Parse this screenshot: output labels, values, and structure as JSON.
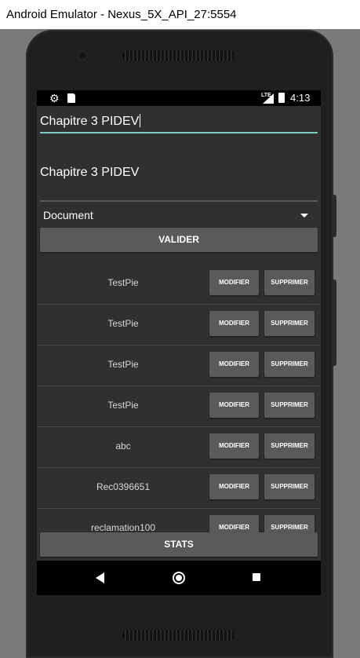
{
  "window": {
    "title": "Android Emulator - Nexus_5X_API_27:5554"
  },
  "status_bar": {
    "time": "4:13",
    "network": "LTE"
  },
  "form": {
    "input_value": "Chapitre 3 PIDEV",
    "display_label": "Chapitre 3 PIDEV",
    "dropdown_value": "Document",
    "validate_label": "VALIDER"
  },
  "list": {
    "modify_label": "MODIFIER",
    "delete_label": "SUPPRIMER",
    "items": [
      {
        "label": "TestPie"
      },
      {
        "label": "TestPie"
      },
      {
        "label": "TestPie"
      },
      {
        "label": "TestPie"
      },
      {
        "label": "abc"
      },
      {
        "label": "Rec0396651"
      },
      {
        "label": "reclamation100"
      }
    ]
  },
  "stats_label": "STATS",
  "colors": {
    "accent": "#7fcbc4",
    "button": "#5a5a5a",
    "screen_bg": "#303030"
  },
  "icons": [
    "settings-gear-icon",
    "sd-card-icon",
    "signal-icon",
    "battery-icon",
    "back-icon",
    "home-icon",
    "recents-icon"
  ]
}
